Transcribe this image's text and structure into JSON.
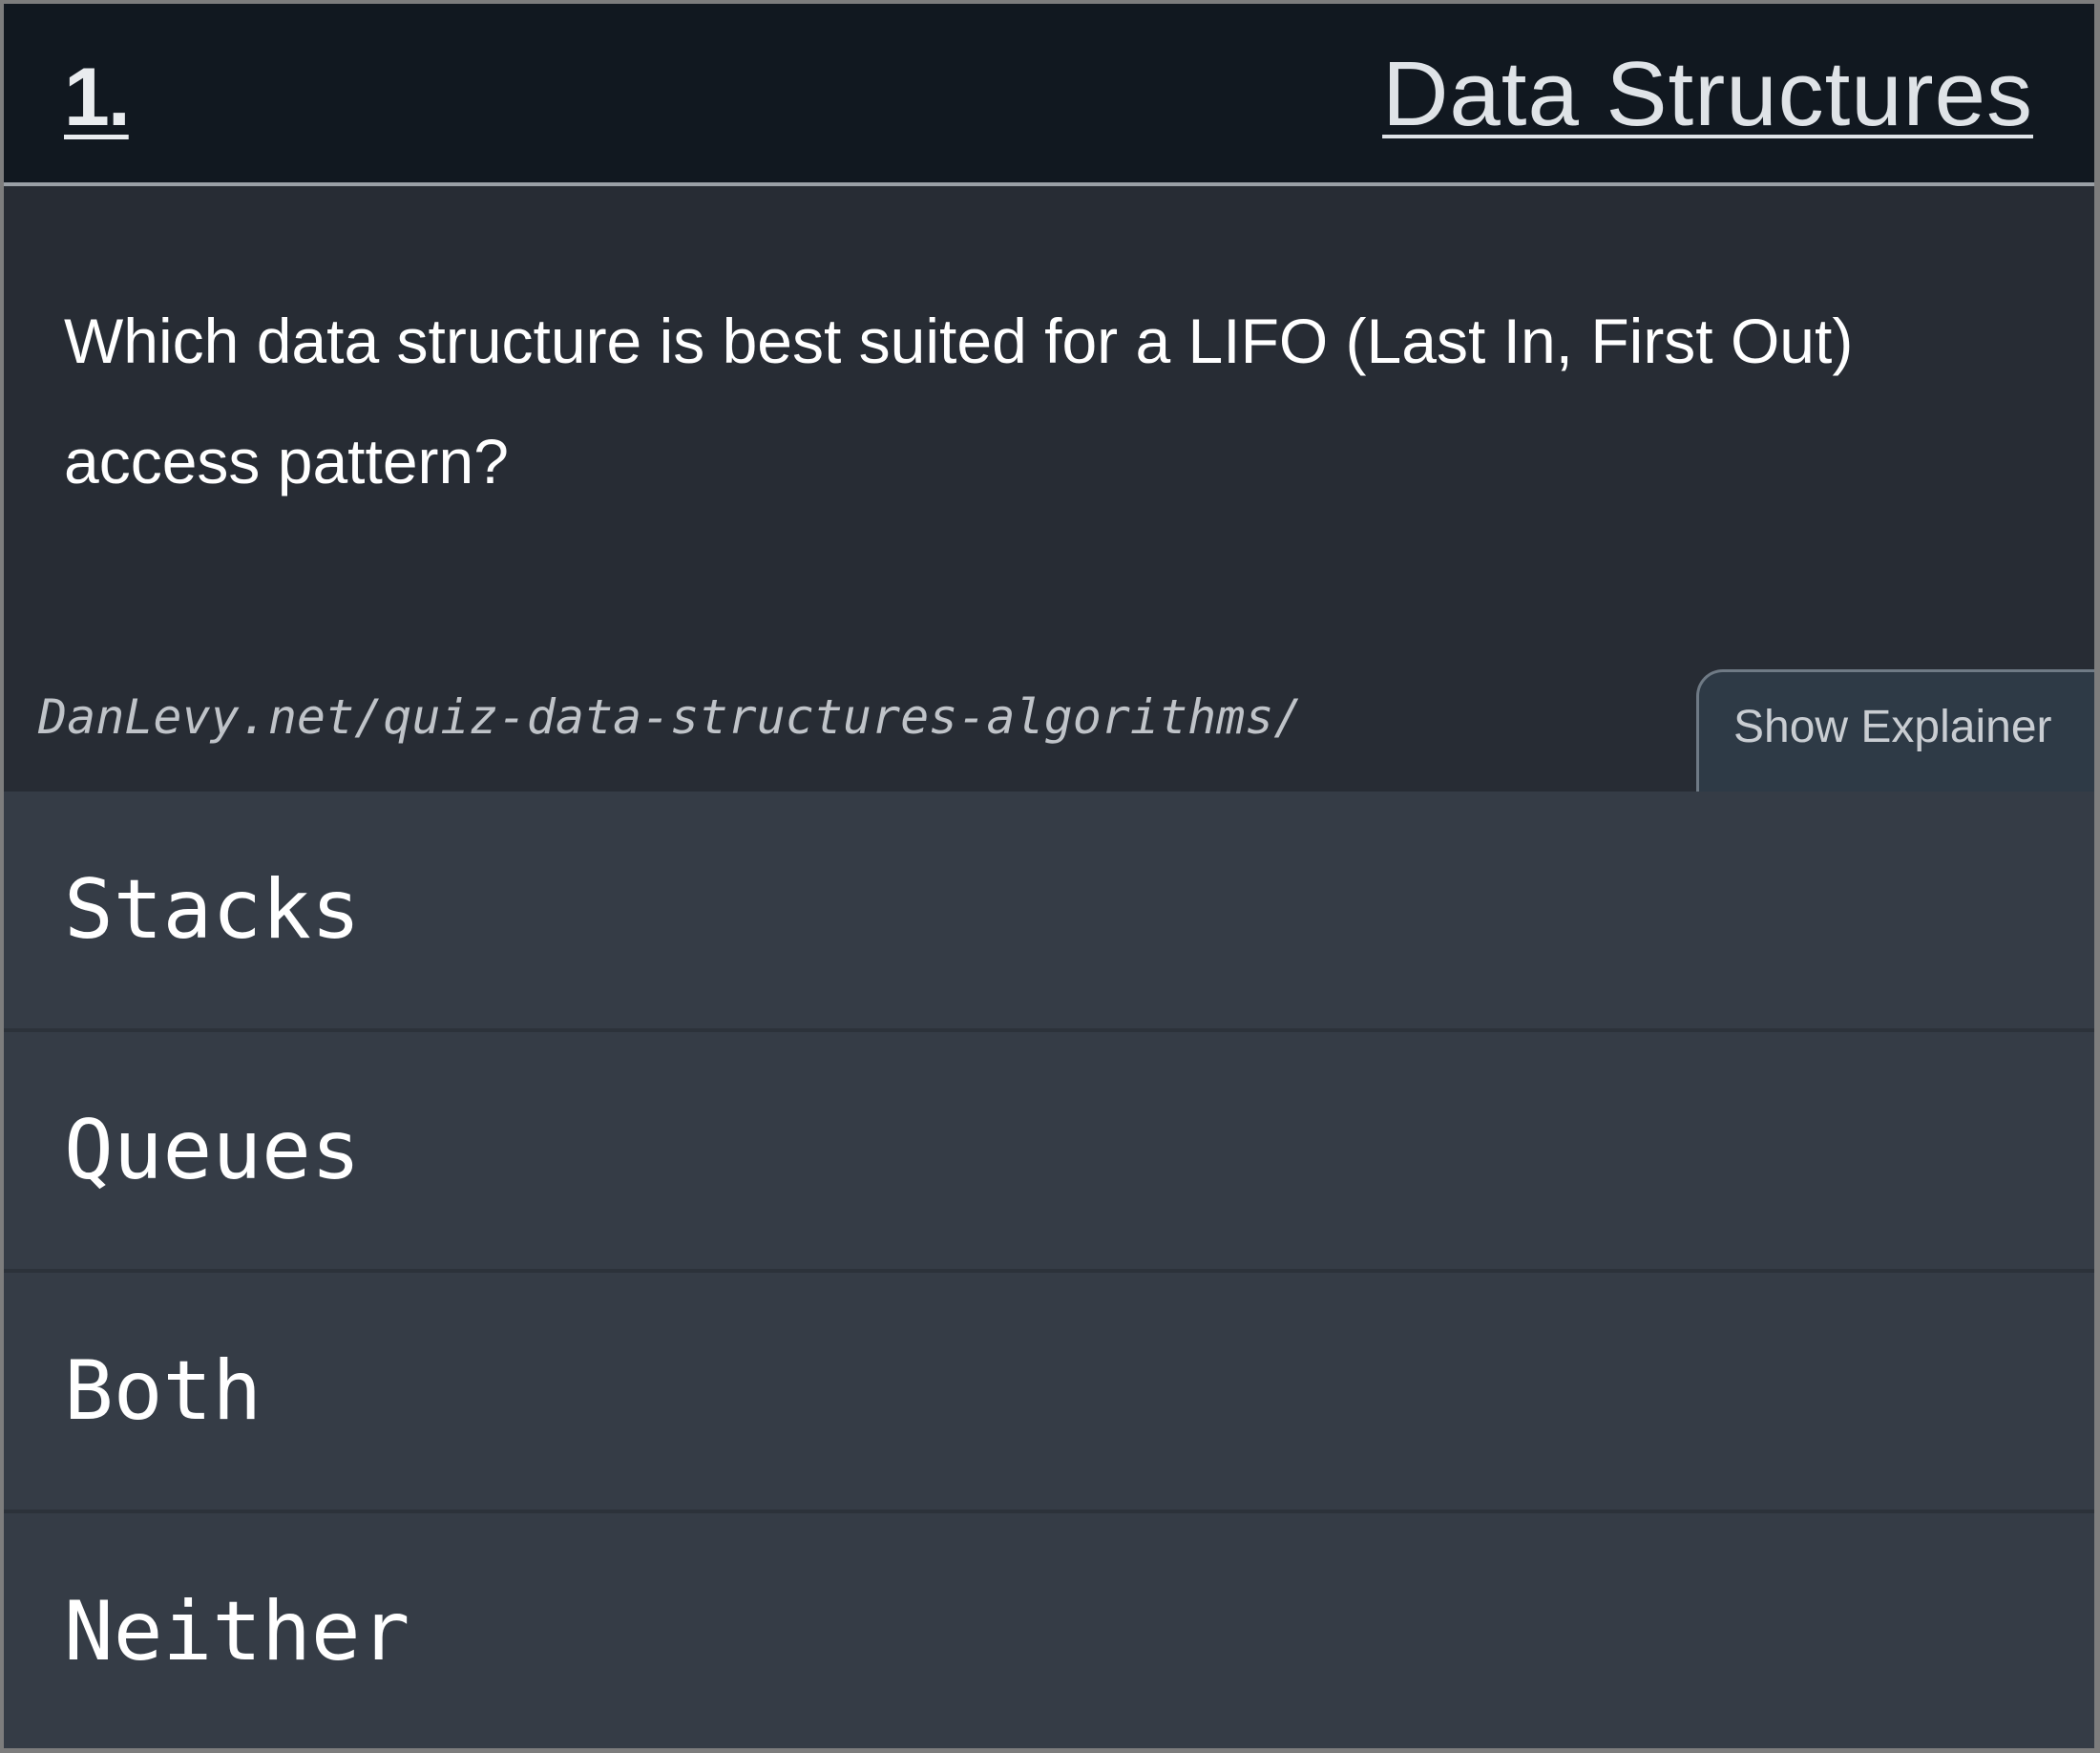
{
  "quiz": {
    "number": "1.",
    "category": "Data Structures",
    "question": "Which data structure is best suited for a LIFO (Last In, First Out) access pattern?",
    "source": "DanLevy.net/quiz-data-structures-algorithms/",
    "explainer_button": "Show Explainer",
    "answers": [
      "Stacks",
      "Queues",
      "Both",
      "Neither"
    ]
  }
}
